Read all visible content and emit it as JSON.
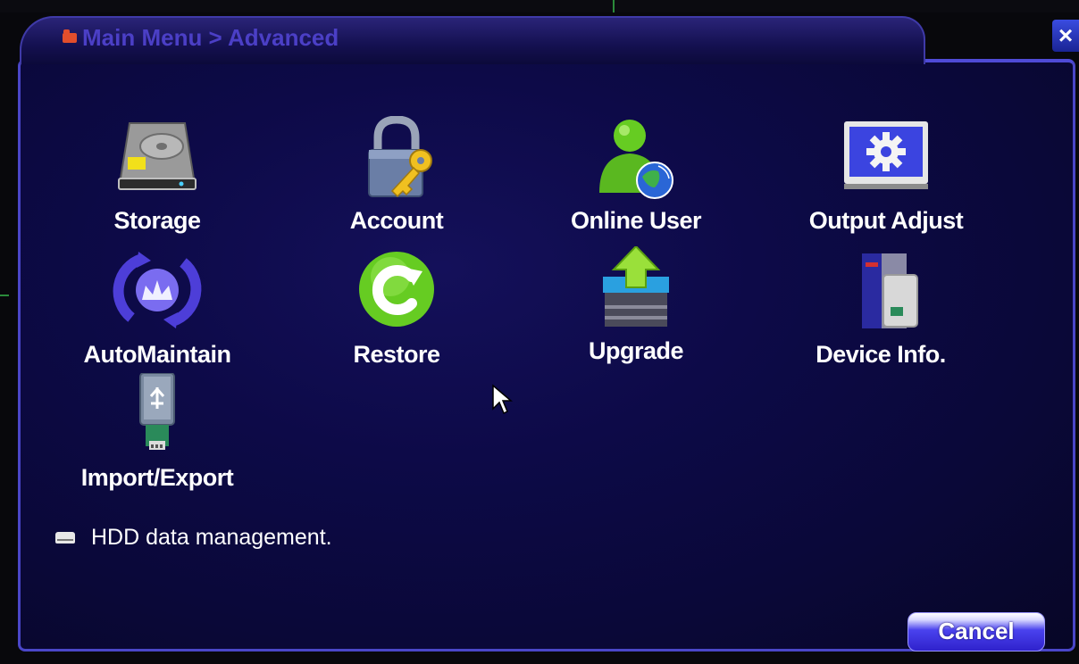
{
  "window": {
    "title": "Main Menu > Advanced",
    "close_symbol": "×"
  },
  "menu_items": [
    {
      "label": "Storage",
      "icon": "hard-drive-icon"
    },
    {
      "label": "Account",
      "icon": "padlock-key-icon"
    },
    {
      "label": "Online User",
      "icon": "user-globe-icon"
    },
    {
      "label": "Output Adjust",
      "icon": "monitor-gear-icon"
    },
    {
      "label": "AutoMaintain",
      "icon": "auto-maintain-icon"
    },
    {
      "label": "Restore",
      "icon": "restore-icon"
    },
    {
      "label": "Upgrade",
      "icon": "upgrade-icon"
    },
    {
      "label": "Device Info.",
      "icon": "device-info-icon"
    },
    {
      "label": "Import/Export",
      "icon": "usb-drive-icon"
    }
  ],
  "description": {
    "text": "HDD data management.",
    "icon": "hdd-small-icon"
  },
  "buttons": {
    "cancel_label": "Cancel"
  },
  "colors": {
    "panel_background": "#0d0a48",
    "border_accent": "#4a46c8",
    "title_text": "#4b3fc6"
  }
}
